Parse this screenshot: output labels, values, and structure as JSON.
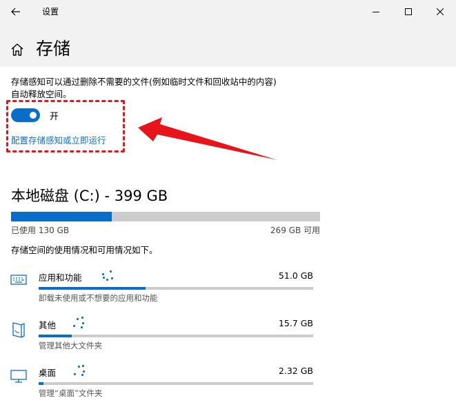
{
  "window": {
    "title": "设置",
    "back_icon": "back-arrow-icon",
    "minimize_icon": "minimize-icon",
    "maximize_icon": "maximize-icon",
    "close_icon": "close-icon"
  },
  "header": {
    "title": "存储",
    "home_icon": "home-icon"
  },
  "storage_sense": {
    "description_line1": "存储感知可以通过删除不需要的文件(例如临时文件和回收站中的内容)",
    "description_line2": "自动释放空间。",
    "toggle_state": "开",
    "toggle_on": true,
    "config_link": "配置存储感知或立即运行"
  },
  "annotation": {
    "color": "#e8141c"
  },
  "disk": {
    "title": "本地磁盘 (C:) - 399 GB",
    "used_label": "已使用 130 GB",
    "free_label": "269 GB 可用",
    "used_fraction": 0.326
  },
  "usage_description": "存储空间的使用情况和可用情况如下。",
  "categories": [
    {
      "icon": "keyboard-icon",
      "name": "应用和功能",
      "size": "51.0 GB",
      "fraction": 0.39,
      "subtitle": "卸载未使用或不想要的应用和功能"
    },
    {
      "icon": "folder-icon",
      "name": "其他",
      "size": "15.7 GB",
      "fraction": 0.12,
      "subtitle": "管理其他大文件夹"
    },
    {
      "icon": "monitor-icon",
      "name": "桌面",
      "size": "2.32 GB",
      "fraction": 0.018,
      "subtitle": "管理“桌面”文件夹"
    }
  ],
  "colors": {
    "accent": "#0a6dc9",
    "bar_bg": "#cccccc",
    "chrome_bg": "#f2f2f2",
    "annotation": "#e8141c"
  }
}
